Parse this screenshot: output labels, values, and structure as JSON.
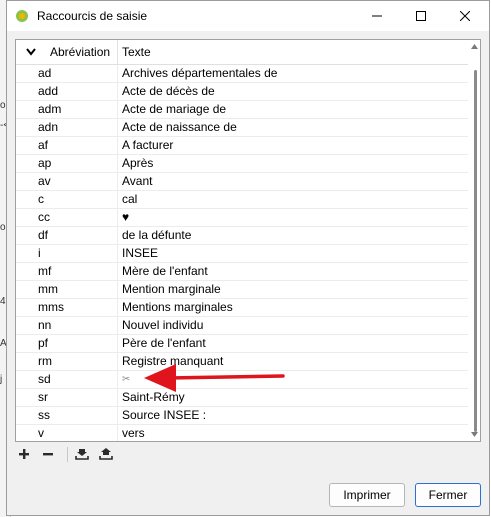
{
  "window": {
    "title": "Raccourcis de saisie"
  },
  "behind": {
    "fragments": [
      "on",
      "-<",
      "or",
      "4",
      "Ag",
      "j"
    ]
  },
  "table": {
    "columns": [
      {
        "label": "Abréviation"
      },
      {
        "label": "Texte"
      }
    ],
    "rows": [
      {
        "abbr": "ad",
        "text": "Archives départementales de"
      },
      {
        "abbr": "add",
        "text": "Acte de décès de"
      },
      {
        "abbr": "adm",
        "text": "Acte de mariage de"
      },
      {
        "abbr": "adn",
        "text": "Acte de naissance de"
      },
      {
        "abbr": "af",
        "text": "A facturer"
      },
      {
        "abbr": "ap",
        "text": "Après"
      },
      {
        "abbr": "av",
        "text": "Avant"
      },
      {
        "abbr": "c",
        "text": "cal"
      },
      {
        "abbr": "cc",
        "text": "♥"
      },
      {
        "abbr": "df",
        "text": "de la défunte"
      },
      {
        "abbr": "i",
        "text": "INSEE"
      },
      {
        "abbr": "mf",
        "text": "Mère de l'enfant"
      },
      {
        "abbr": "mm",
        "text": "Mention marginale"
      },
      {
        "abbr": "mms",
        "text": "Mentions marginales"
      },
      {
        "abbr": "nn",
        "text": "Nouvel individu"
      },
      {
        "abbr": "pf",
        "text": "Père de l'enfant"
      },
      {
        "abbr": "rm",
        "text": "Registre manquant"
      },
      {
        "abbr": "sd",
        "text": "✂"
      },
      {
        "abbr": "sr",
        "text": "Saint-Rémy"
      },
      {
        "abbr": "ss",
        "text": "Source INSEE :"
      },
      {
        "abbr": "v",
        "text": "vers"
      }
    ]
  },
  "buttons": {
    "print": "Imprimer",
    "close": "Fermer"
  },
  "colors": {
    "arrow": "#e0141c",
    "accent": "#2a6fd6"
  }
}
